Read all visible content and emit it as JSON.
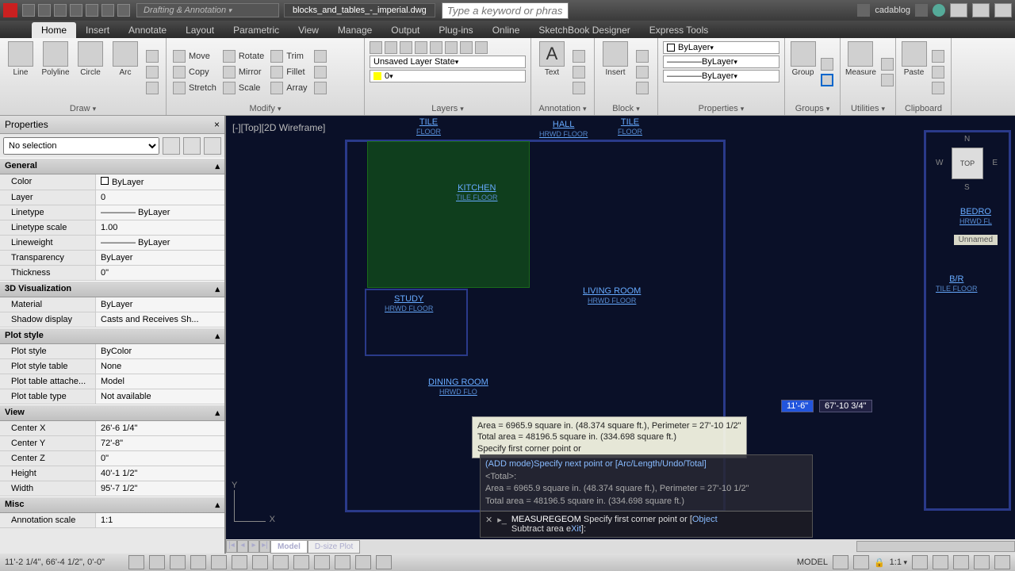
{
  "title": {
    "workspace": "Drafting & Annotation",
    "filename": "blocks_and_tables_-_imperial.dwg",
    "search_placeholder": "Type a keyword or phrase",
    "user": "cadablog"
  },
  "ribbon": {
    "tabs": [
      "Home",
      "Insert",
      "Annotate",
      "Layout",
      "Parametric",
      "View",
      "Manage",
      "Output",
      "Plug-ins",
      "Online",
      "SketchBook Designer",
      "Express Tools"
    ],
    "active": "Home",
    "panels": {
      "draw": {
        "label": "Draw",
        "items": [
          "Line",
          "Polyline",
          "Circle",
          "Arc"
        ]
      },
      "modify": {
        "label": "Modify",
        "items": [
          "Move",
          "Rotate",
          "Trim",
          "Copy",
          "Mirror",
          "Fillet",
          "Stretch",
          "Scale",
          "Array"
        ]
      },
      "layers": {
        "label": "Layers",
        "state": "Unsaved Layer State",
        "current": "0"
      },
      "annotation": {
        "label": "Annotation",
        "text": "Text"
      },
      "block": {
        "label": "Block",
        "insert": "Insert"
      },
      "properties": {
        "label": "Properties",
        "color": "ByLayer",
        "ltype": "ByLayer",
        "lweight": "ByLayer"
      },
      "groups": {
        "label": "Groups",
        "btn": "Group"
      },
      "utilities": {
        "label": "Utilities",
        "btn": "Measure"
      },
      "clipboard": {
        "label": "Clipboard",
        "btn": "Paste"
      }
    }
  },
  "properties": {
    "title": "Properties",
    "selection": "No selection",
    "groups": [
      {
        "name": "General",
        "rows": [
          {
            "k": "Color",
            "v": "ByLayer",
            "swatch": true
          },
          {
            "k": "Layer",
            "v": "0"
          },
          {
            "k": "Linetype",
            "v": "———— ByLayer"
          },
          {
            "k": "Linetype scale",
            "v": "1.00"
          },
          {
            "k": "Lineweight",
            "v": "———— ByLayer"
          },
          {
            "k": "Transparency",
            "v": "ByLayer"
          },
          {
            "k": "Thickness",
            "v": "0\""
          }
        ]
      },
      {
        "name": "3D Visualization",
        "rows": [
          {
            "k": "Material",
            "v": "ByLayer"
          },
          {
            "k": "Shadow display",
            "v": "Casts and Receives Sh..."
          }
        ]
      },
      {
        "name": "Plot style",
        "rows": [
          {
            "k": "Plot style",
            "v": "ByColor"
          },
          {
            "k": "Plot style table",
            "v": "None"
          },
          {
            "k": "Plot table attache...",
            "v": "Model"
          },
          {
            "k": "Plot table type",
            "v": "Not available"
          }
        ]
      },
      {
        "name": "View",
        "rows": [
          {
            "k": "Center X",
            "v": "26'-6 1/4\""
          },
          {
            "k": "Center Y",
            "v": "72'-8\""
          },
          {
            "k": "Center Z",
            "v": "0\""
          },
          {
            "k": "Height",
            "v": "40'-1 1/2\""
          },
          {
            "k": "Width",
            "v": "95'-7 1/2\""
          }
        ]
      },
      {
        "name": "Misc",
        "rows": [
          {
            "k": "Annotation scale",
            "v": "1:1"
          }
        ]
      }
    ]
  },
  "canvas": {
    "viewlabel": "[-][Top][2D Wireframe]",
    "viewcube": "TOP",
    "unnamed": "Unnamed",
    "rooms": {
      "kitchen": {
        "name": "KITCHEN",
        "sub": "TILE FLOOR"
      },
      "study": {
        "name": "STUDY",
        "sub": "HRWD FLOOR"
      },
      "dining": {
        "name": "DINING ROOM",
        "sub": "HRWD FLO"
      },
      "living": {
        "name": "LIVING  ROOM",
        "sub": "HRWD FLOOR"
      },
      "hall": {
        "name": "HALL",
        "sub": "HRWD FLOOR"
      },
      "br": {
        "name": "B/R",
        "sub": "TILE FLOOR"
      },
      "bedro": {
        "name": "BEDRO",
        "sub": "HRWD FL"
      },
      "tile1": {
        "name": "TILE",
        "sub": "FLOOR"
      },
      "tile2": {
        "name": "TILE",
        "sub": "FLOOR"
      }
    },
    "tooltip": {
      "l1": "Area = 6965.9 square in. (48.374 square ft.), Perimeter = 27'-10 1/2\"",
      "l2": "Total area = 48196.5 square in. (334.698 square ft.)",
      "l3": "Specify first corner point or"
    },
    "dim1": "11'-6\"",
    "dim2": "67'-10 3/4\"",
    "cmdhist": {
      "l1": "(ADD mode)Specify next point or [Arc/Length/Undo/Total]",
      "l2": "<Total>:",
      "l3": "Area = 6965.9 square in. (48.374 square ft.), Perimeter = 27'-10 1/2\"",
      "l4": "Total area = 48196.5 square in. (334.698 square ft.)"
    },
    "cmdline": {
      "pre": "MEASUREGEOM",
      "body": " Specify first corner point or [",
      "o1": "Object",
      "mid": " Subtract area e",
      "o2": "Xit",
      "end": "]:"
    }
  },
  "tabs": {
    "model": "Model",
    "dsize": "D-size Plot"
  },
  "status": {
    "coords": "11'-2 1/4\",  66'-4 1/2\",  0'-0\"",
    "model": "MODEL",
    "scale": "1:1"
  }
}
